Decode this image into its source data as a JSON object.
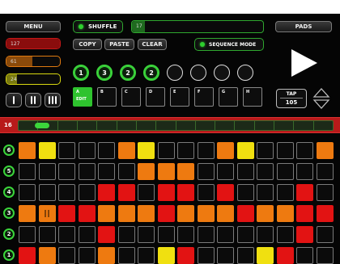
{
  "top": {
    "menu_label": "MENU",
    "shuffle_label": "SHUFFLE",
    "shuffle_value": "17",
    "shuffle_fraction": 0.1,
    "pads_label": "PADS"
  },
  "sliders": [
    {
      "value": "127",
      "fraction": 1.0,
      "color": "#8a0d0d",
      "border": "#c21818"
    },
    {
      "value": "61",
      "fraction": 0.48,
      "color": "#8a4a0a",
      "border": "#e07a10"
    },
    {
      "value": "24",
      "fraction": 0.19,
      "color": "#7a7a10",
      "border": "#d8d810"
    }
  ],
  "edit_buttons": {
    "copy": "COPY",
    "paste": "PASTE",
    "clear": "CLEAR"
  },
  "sequence_mode_label": "SEQUENCE MODE",
  "sequence_chain": [
    "1",
    "3",
    "2",
    "2",
    "",
    "",
    "",
    ""
  ],
  "patterns": [
    {
      "letter": "A",
      "sub": "EDIT",
      "active": true
    },
    {
      "letter": "B",
      "sub": "",
      "active": false
    },
    {
      "letter": "C",
      "sub": "",
      "active": false
    },
    {
      "letter": "D",
      "sub": "",
      "active": false
    },
    {
      "letter": "E",
      "sub": "",
      "active": false
    },
    {
      "letter": "F",
      "sub": "",
      "active": false
    },
    {
      "letter": "G",
      "sub": "",
      "active": false
    },
    {
      "letter": "H",
      "sub": "",
      "active": false
    }
  ],
  "tap": {
    "label": "TAP",
    "bpm": "105"
  },
  "steps": {
    "count_label": "16",
    "position": 0.05
  },
  "rows": [
    {
      "label": "6",
      "cells": "oy...oy...oy...oy..."
    },
    {
      "label": "5",
      "cells": "......ooo.......yP."
    },
    {
      "label": "4",
      "cells": "....rr.rr.r...r...."
    },
    {
      "label": "3",
      "cells": "oPrroooroooroorr"
    },
    {
      "label": "2",
      "cells": "....r.........r..."
    },
    {
      "label": "1",
      "cells": "ro..o..yr...yr...."
    }
  ],
  "colors": {
    "orange": "#ee7a10",
    "yellow": "#f0e010",
    "red": "#e21313",
    "green": "#3bd63b",
    "panel": "#b81a1a"
  }
}
